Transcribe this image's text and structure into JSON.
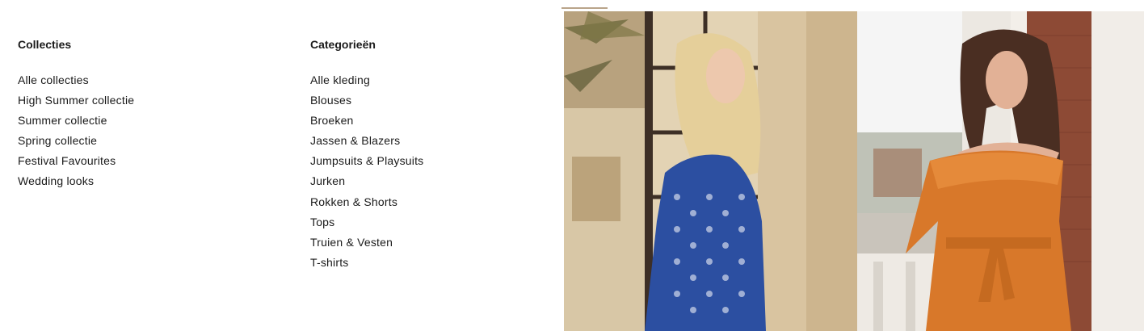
{
  "collections": {
    "heading": "Collecties",
    "items": [
      "Alle collecties",
      "High Summer collectie",
      "Summer collectie",
      "Spring collectie",
      "Festival Favourites",
      "Wedding looks"
    ]
  },
  "categories": {
    "heading": "Categorieën",
    "items": [
      "Alle kleding",
      "Blouses",
      "Broeken",
      "Jassen & Blazers",
      "Jumpsuits & Playsuits",
      "Jurken",
      "Rokken & Shorts",
      "Tops",
      "Truien & Vesten",
      "T-shirts"
    ]
  },
  "colors": {
    "text": "#1a1a1a",
    "indicator": "#b9a48a",
    "blue_dress": "#2c4fa1",
    "orange_dress": "#d8782a"
  },
  "images": {
    "left": "woman-in-blue-print-dress-photo",
    "right": "woman-in-orange-off-shoulder-dress-photo"
  }
}
